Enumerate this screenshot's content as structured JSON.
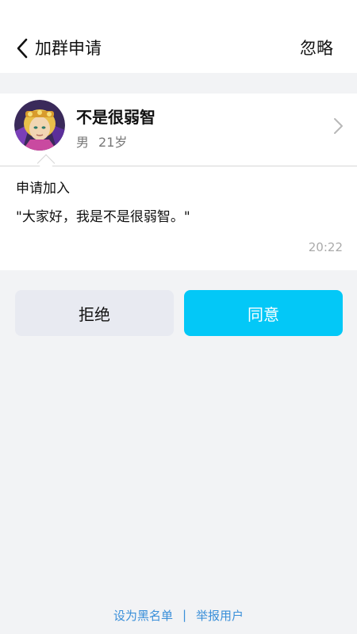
{
  "header": {
    "back_icon": "chevron-left-icon",
    "title": "加群申请",
    "ignore_label": "忽略"
  },
  "applicant": {
    "name": "不是很弱智",
    "gender": "男",
    "age": "21岁",
    "avatar_icon": "user-avatar",
    "detail_icon": "chevron-right-icon"
  },
  "request": {
    "label": "申请加入",
    "message": "\"大家好，我是不是很弱智。\"",
    "time": "20:22"
  },
  "actions": {
    "reject_label": "拒绝",
    "agree_label": "同意",
    "agree_color": "#03c8f7"
  },
  "footer": {
    "blacklist_label": "设为黑名单",
    "separator": "|",
    "report_label": "举报用户",
    "link_color": "#3a8fd9"
  }
}
